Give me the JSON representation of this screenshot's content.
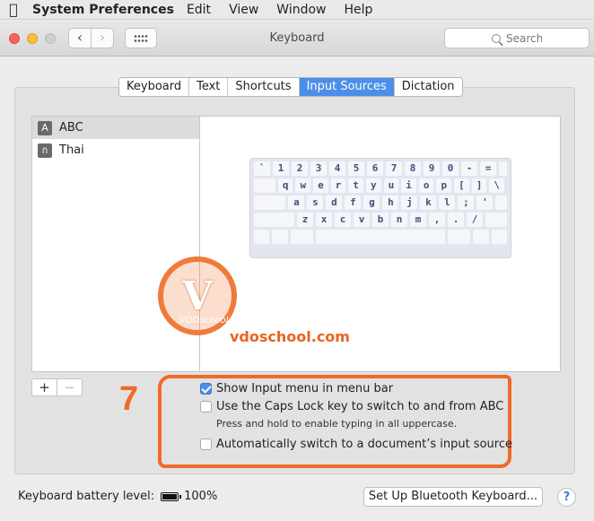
{
  "menubar": {
    "app": "System Preferences",
    "items": [
      "Edit",
      "View",
      "Window",
      "Help"
    ]
  },
  "window": {
    "title": "Keyboard",
    "search_placeholder": "Search"
  },
  "tabs": [
    {
      "label": "Keyboard",
      "active": false
    },
    {
      "label": "Text",
      "active": false
    },
    {
      "label": "Shortcuts",
      "active": false
    },
    {
      "label": "Input Sources",
      "active": true
    },
    {
      "label": "Dictation",
      "active": false
    }
  ],
  "input_sources": [
    {
      "icon_char": "A",
      "label": "ABC",
      "selected": true
    },
    {
      "icon_char": "ก",
      "label": "Thai",
      "selected": false
    }
  ],
  "keyboard_rows": [
    [
      "`",
      "1",
      "2",
      "3",
      "4",
      "5",
      "6",
      "7",
      "8",
      "9",
      "0",
      "-",
      "="
    ],
    [
      "q",
      "w",
      "e",
      "r",
      "t",
      "y",
      "u",
      "i",
      "o",
      "p",
      "[",
      "]",
      "\\"
    ],
    [
      "a",
      "s",
      "d",
      "f",
      "g",
      "h",
      "j",
      "k",
      "l",
      ";",
      "'"
    ],
    [
      "z",
      "x",
      "c",
      "v",
      "b",
      "n",
      "m",
      ",",
      ".",
      "/"
    ]
  ],
  "list_buttons": {
    "add": "+",
    "remove": "−"
  },
  "watermark": {
    "logo_letter": "V",
    "logo_text": "VDOschool",
    "brand": "vdoschool.com"
  },
  "annotation": {
    "step": "7"
  },
  "options": [
    {
      "label": "Show Input menu in menu bar",
      "checked": true
    },
    {
      "label": "Use the Caps Lock key to switch to and from ABC",
      "checked": false
    },
    {
      "label": "Automatically switch to a document’s input source",
      "checked": false
    }
  ],
  "caps_lock_hint": "Press and hold to enable typing in all uppercase.",
  "footer": {
    "battery_label": "Keyboard battery level:",
    "battery_level": "100%",
    "bluetooth_button": "Set Up Bluetooth Keyboard...",
    "help": "?"
  },
  "colors": {
    "accent": "#4c8fe9",
    "annotation": "#ef6a28"
  }
}
